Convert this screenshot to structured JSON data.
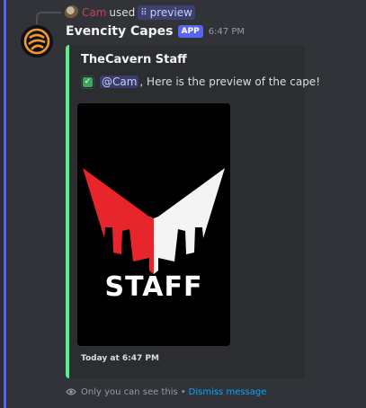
{
  "reply": {
    "username": "Cam",
    "verb": "used",
    "command": "preview",
    "command_icon": "slash-command-icon"
  },
  "message": {
    "author": "Evencity Capes",
    "badge": "APP",
    "timestamp": "6:47 PM"
  },
  "embed": {
    "accent_color": "#57f287",
    "title": "TheCavern Staff",
    "mention": "@Cam",
    "description_suffix": ", Here is the preview of the cape!",
    "image_text": "STAFF",
    "footer": "Today at 6:47 PM"
  },
  "ephemeral": {
    "notice": "Only you can see this",
    "separator": "•",
    "dismiss_label": "Dismiss message"
  },
  "colors": {
    "background": "#323339",
    "embed_background": "#2b2d31",
    "blurple": "#5865f2",
    "link": "#00a8fc",
    "logo_orange": "#f29a32",
    "logo_red": "#e8252b"
  }
}
